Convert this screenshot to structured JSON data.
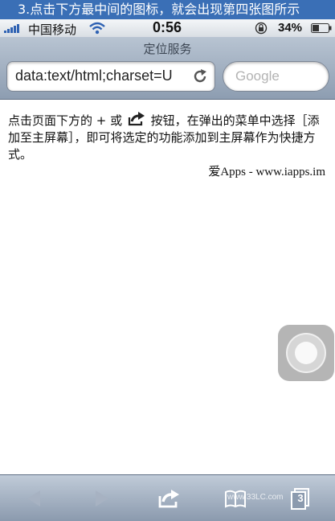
{
  "caption": {
    "text": "3.点击下方最中间的图标，就会出现第四张图所示"
  },
  "status_bar": {
    "carrier": "中国移动",
    "time": "0:56",
    "battery": "34%"
  },
  "header": {
    "title": "定位服务",
    "address_value": "data:text/html;charset=U",
    "search_placeholder": "Google"
  },
  "content": {
    "instruction_before": "点击页面下方的 + 或",
    "instruction_after": "按钮，在弹出的菜单中选择［添加至主屏幕］，即可将选定的功能添加到主屏幕作为快捷方式。",
    "credit": "爱Apps - www.iapps.im"
  },
  "toolbar": {
    "pages_count": "3",
    "watermark": "www.33LC.com"
  },
  "icons": {
    "back": "back-arrow-icon",
    "forward": "forward-arrow-icon",
    "share": "share-icon",
    "bookmarks": "bookmarks-icon",
    "pages": "pages-icon",
    "reload": "reload-icon"
  },
  "colors": {
    "caption_bg": "#3a6fb6",
    "toolbar_bg": "#8b9aae",
    "signal": "#2f62b3"
  }
}
